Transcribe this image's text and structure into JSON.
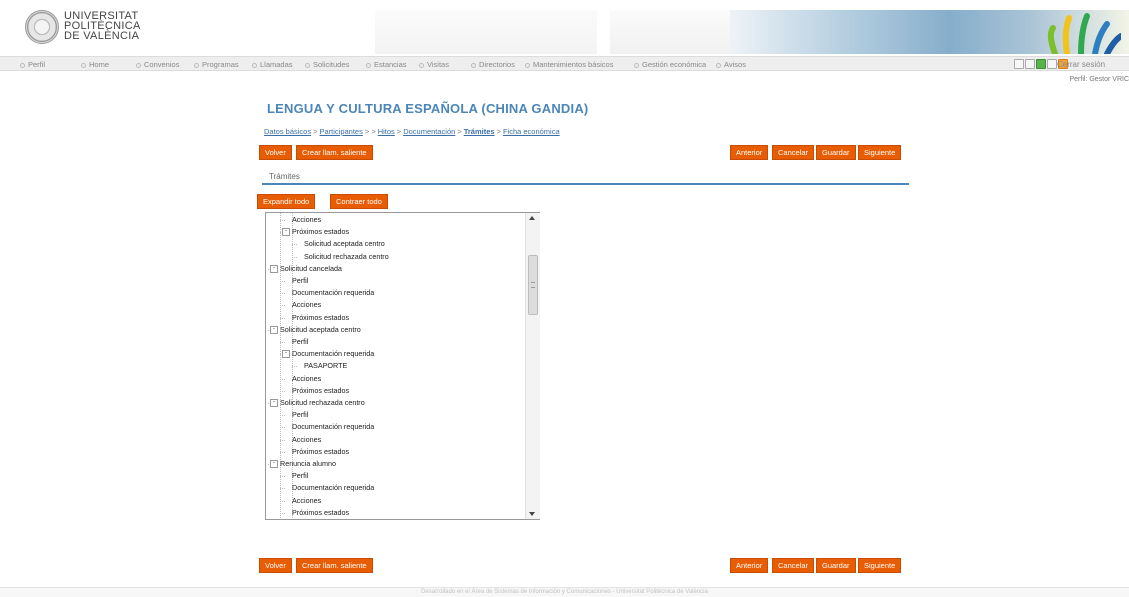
{
  "header": {
    "university_lines": [
      "UNIVERSITAT",
      "POLITÈCNICA",
      "DE VALÈNCIA"
    ]
  },
  "nav": {
    "items": [
      "Perfil",
      "Home",
      "Convenios",
      "Programas",
      "Llamadas",
      "Solicitudes",
      "Estancias",
      "Visitas",
      "Directorios",
      "Mantenimientos básicos",
      "Gestión económica",
      "Avisos"
    ],
    "logout": "Cerrar sesión",
    "profile": "Perfil: Gestor VRIC"
  },
  "page": {
    "title": "LENGUA Y CULTURA ESPAÑOLA (CHINA GANDIA)",
    "breadcrumb": [
      {
        "label": "Datos básicos",
        "link": true
      },
      {
        "label": ">",
        "link": false
      },
      {
        "label": "Participantes",
        "link": true
      },
      {
        "label": "> >",
        "link": false
      },
      {
        "label": "Hitos",
        "link": true
      },
      {
        "label": ">",
        "link": false
      },
      {
        "label": "Documentación",
        "link": true
      },
      {
        "label": ">",
        "link": false
      },
      {
        "label": "Trámites",
        "link": true,
        "current": true
      },
      {
        "label": ">",
        "link": false
      },
      {
        "label": "Ficha económica",
        "link": true
      }
    ],
    "buttons": {
      "back": "Volver",
      "create_call": "Crear llam. saliente",
      "previous": "Anterior",
      "cancel": "Cancelar",
      "save": "Guardar",
      "next": "Siguiente"
    },
    "section_title": "Trámites",
    "expand_all": "Expandir todo",
    "collapse_all": "Contraer todo"
  },
  "tree": {
    "rows": [
      {
        "label": "Acciones",
        "level": 2,
        "toggle": ""
      },
      {
        "label": "Próximos estados",
        "level": 2,
        "toggle": "-"
      },
      {
        "label": "Solicitud aceptada centro",
        "level": 3,
        "toggle": ""
      },
      {
        "label": "Solicitud rechazada centro",
        "level": 3,
        "toggle": ""
      },
      {
        "label": "Solicitud cancelada",
        "level": 1,
        "toggle": "-"
      },
      {
        "label": "Perfil",
        "level": 2,
        "toggle": ""
      },
      {
        "label": "Documentación requerida",
        "level": 2,
        "toggle": ""
      },
      {
        "label": "Acciones",
        "level": 2,
        "toggle": ""
      },
      {
        "label": "Próximos estados",
        "level": 2,
        "toggle": ""
      },
      {
        "label": "Solicitud aceptada centro",
        "level": 1,
        "toggle": "-"
      },
      {
        "label": "Perfil",
        "level": 2,
        "toggle": ""
      },
      {
        "label": "Documentación requerida",
        "level": 2,
        "toggle": "-"
      },
      {
        "label": "PASAPORTE",
        "level": 3,
        "toggle": ""
      },
      {
        "label": "Acciones",
        "level": 2,
        "toggle": ""
      },
      {
        "label": "Próximos estados",
        "level": 2,
        "toggle": ""
      },
      {
        "label": "Solicitud rechazada centro",
        "level": 1,
        "toggle": "-"
      },
      {
        "label": "Perfil",
        "level": 2,
        "toggle": ""
      },
      {
        "label": "Documentación requerida",
        "level": 2,
        "toggle": ""
      },
      {
        "label": "Acciones",
        "level": 2,
        "toggle": ""
      },
      {
        "label": "Próximos estados",
        "level": 2,
        "toggle": ""
      },
      {
        "label": "Renuncia alumno",
        "level": 1,
        "toggle": "-"
      },
      {
        "label": "Perfil",
        "level": 2,
        "toggle": ""
      },
      {
        "label": "Documentación requerida",
        "level": 2,
        "toggle": ""
      },
      {
        "label": "Acciones",
        "level": 2,
        "toggle": ""
      },
      {
        "label": "Próximos estados",
        "level": 2,
        "toggle": ""
      }
    ]
  },
  "footer": {
    "text": "Desarrollado en el Área de Sistemas de Información y Comunicaciones - Universitat Politècnica de València"
  },
  "colors": {
    "accent_orange": "#e85d04",
    "title_blue": "#4c86b8",
    "link_blue": "#3a6ea5"
  }
}
